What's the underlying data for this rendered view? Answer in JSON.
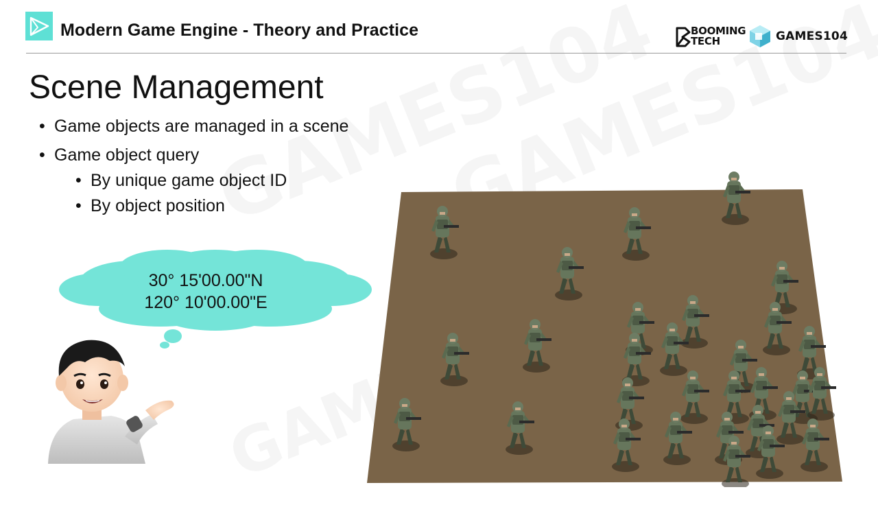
{
  "header": {
    "title": "Modern Game Engine - Theory and Practice",
    "brand_booming_line1": "BOOMING",
    "brand_booming_line2": "TECH",
    "brand_games": "GAMES104"
  },
  "slide": {
    "title": "Scene Management",
    "bullets": [
      {
        "text": "Game objects are managed in a scene"
      },
      {
        "text": "Game object query"
      }
    ],
    "sub_bullets": [
      {
        "text": "By unique game object ID"
      },
      {
        "text": "By object position"
      }
    ]
  },
  "thought_bubble": {
    "line1": "30°  15'00.00\"N",
    "line2": "120°  10'00.00\"E"
  },
  "colors": {
    "accent_teal": "#5ee0d5",
    "cloud_fill": "#74e4d8",
    "ground_brown": "#7a6448",
    "soldier_green": "#5f6e55"
  },
  "icons": {
    "header_logo": "play-triangle-icon",
    "booming": "booming-tech-logo",
    "games": "games104-cube-logo"
  }
}
